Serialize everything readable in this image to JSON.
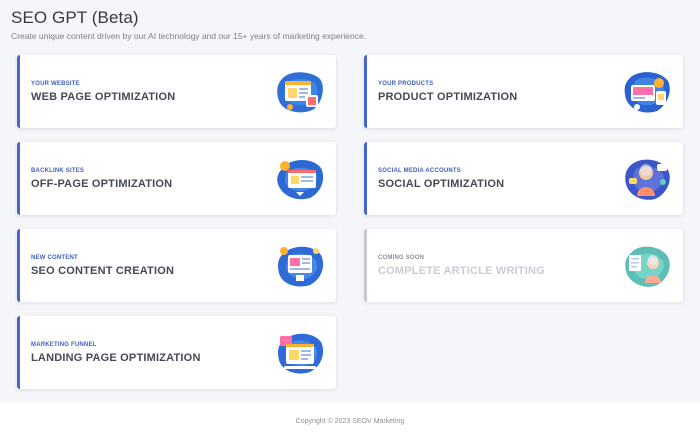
{
  "header": {
    "title": "SEO GPT (Beta)",
    "subtitle": "Create unique content driven by our AI technology and our 15+ years of marketing experience."
  },
  "cards": [
    {
      "eyebrow": "YOUR WEBSITE",
      "title": "WEB PAGE OPTIMIZATION",
      "icon": "webpage-illustration-icon",
      "enabled": true
    },
    {
      "eyebrow": "YOUR PRODUCTS",
      "title": "PRODUCT OPTIMIZATION",
      "icon": "product-illustration-icon",
      "enabled": true
    },
    {
      "eyebrow": "BACKLINK SITES",
      "title": "OFF-PAGE OPTIMIZATION",
      "icon": "offpage-illustration-icon",
      "enabled": true
    },
    {
      "eyebrow": "SOCIAL MEDIA ACCOUNTS",
      "title": "SOCIAL OPTIMIZATION",
      "icon": "social-illustration-icon",
      "enabled": true
    },
    {
      "eyebrow": "NEW CONTENT",
      "title": "SEO CONTENT CREATION",
      "icon": "content-illustration-icon",
      "enabled": true
    },
    {
      "eyebrow": "COMING SOON",
      "title": "COMPLETE ARTICLE WRITING",
      "icon": "article-illustration-icon",
      "enabled": false
    },
    {
      "eyebrow": "MARKETING FUNNEL",
      "title": "LANDING PAGE OPTIMIZATION",
      "icon": "landing-illustration-icon",
      "enabled": true
    }
  ],
  "footer": {
    "copyright": "Copyright © 2023 SEOV Marketing"
  },
  "colors": {
    "accent": "#4666c9",
    "disabled_border": "#c6c9d2",
    "background": "#f5f6fa"
  }
}
